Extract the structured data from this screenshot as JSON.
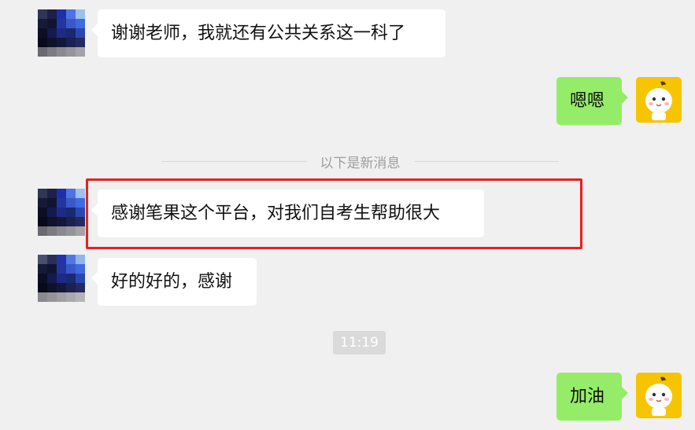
{
  "messages": [
    {
      "side": "left",
      "text": "谢谢老师，我就还有公共关系这一科了"
    },
    {
      "side": "right",
      "text": "嗯嗯"
    },
    {
      "side": "left",
      "text": "感谢笔果这个平台，对我们自考生帮助很大"
    },
    {
      "side": "left",
      "text": "好的好的，感谢"
    },
    {
      "side": "right",
      "text": "加油"
    }
  ],
  "divider": {
    "label": "以下是新消息"
  },
  "timestamp": "11:19",
  "colors": {
    "background": "#f0f0f0",
    "incoming_bubble": "#ffffff",
    "outgoing_bubble": "#95ec69",
    "highlight_border": "#e82020",
    "self_avatar": "#f6c400"
  },
  "icons": {
    "contact_avatar": "pixelated-avatar-icon",
    "self_avatar": "cartoon-face-avatar-icon"
  }
}
